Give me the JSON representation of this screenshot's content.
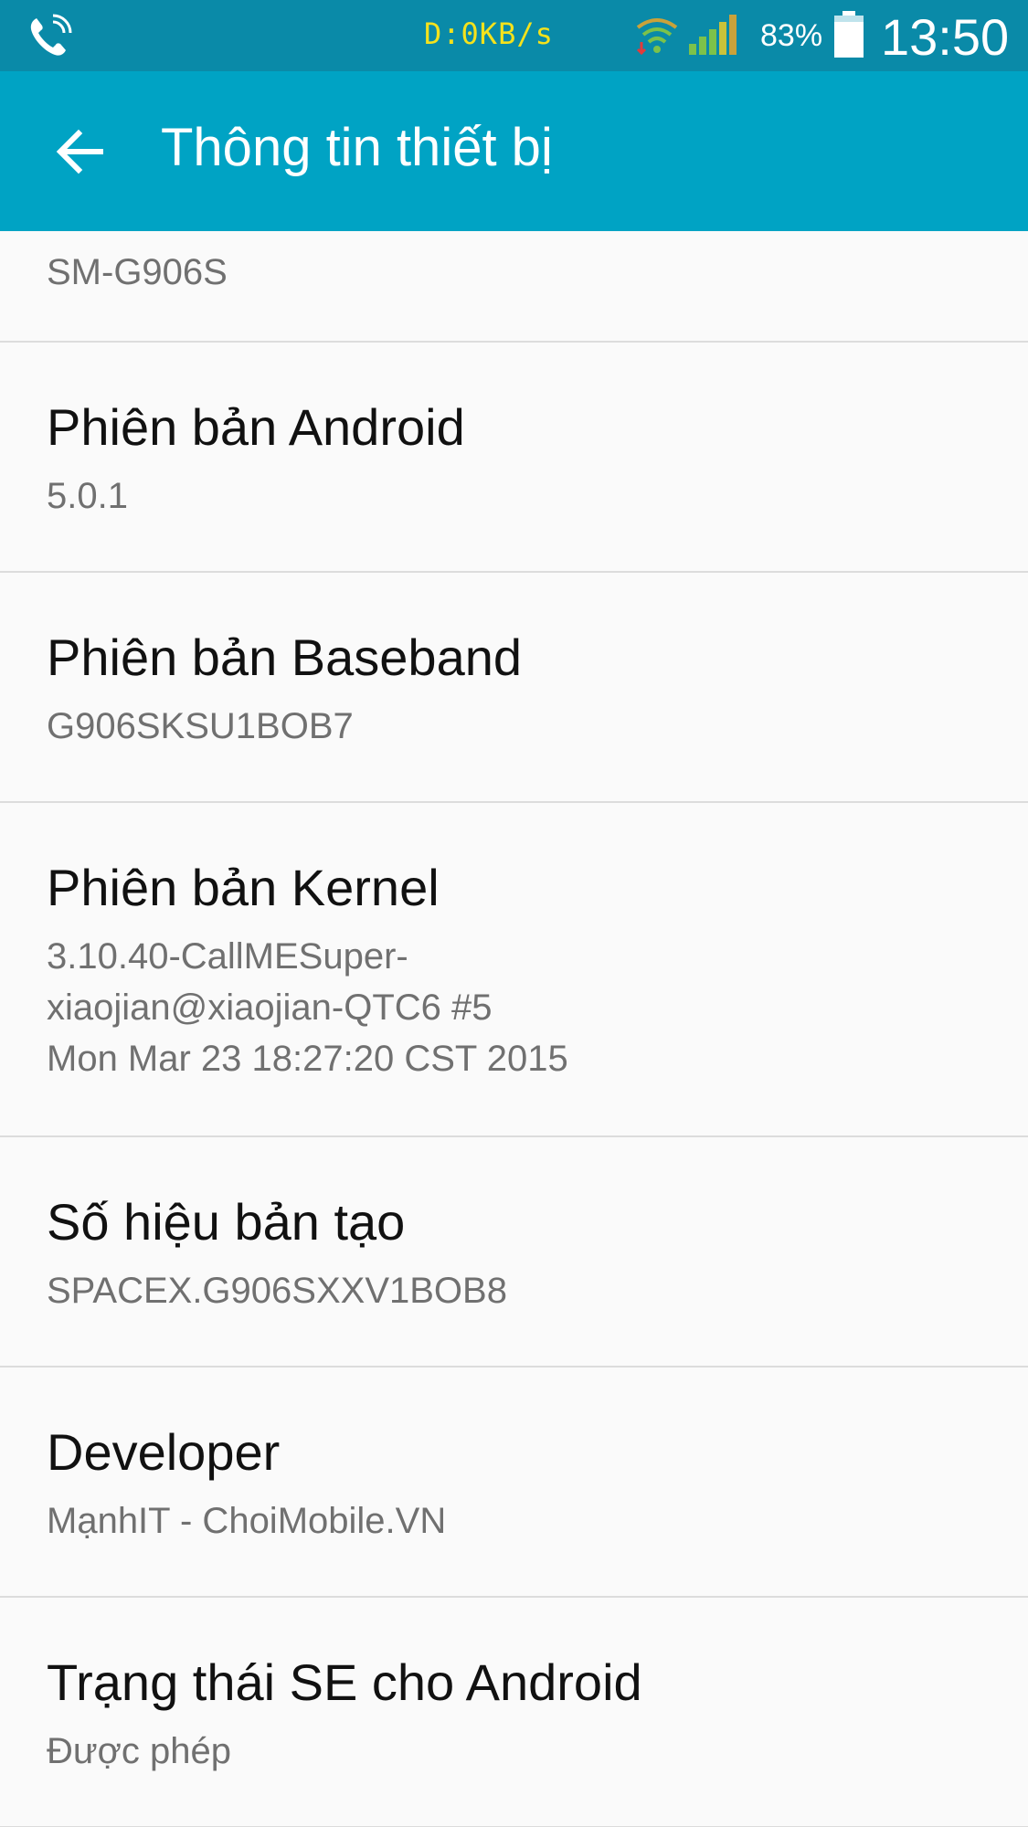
{
  "status_bar": {
    "net_speed": "D:0KB/s",
    "battery_percent": "83%",
    "time": "13:50",
    "icons": [
      "call-icon",
      "wifi-icon",
      "signal-icon",
      "battery-icon"
    ]
  },
  "app_bar": {
    "title": "Thông tin thiết bị",
    "back_icon": "arrow-left-icon"
  },
  "list": {
    "partial_value": "SM-G906S",
    "items": [
      {
        "label": "Phiên bản Android",
        "value": "5.0.1"
      },
      {
        "label": "Phiên bản Baseband",
        "value": "G906SKSU1BOB7"
      },
      {
        "label": "Phiên bản Kernel",
        "value": "3.10.40-CallMESuper-\nxiaojian@xiaojian-QTC6 #5\nMon Mar 23 18:27:20 CST 2015"
      },
      {
        "label": "Số hiệu bản tạo",
        "value": "SPACEX.G906SXXV1BOB8"
      },
      {
        "label": "Developer",
        "value": "MạnhIT - ChoiMobile.VN"
      },
      {
        "label": "Trạng thái SE cho Android",
        "value": "Được phép"
      }
    ]
  },
  "colors": {
    "status_bar": "#0a8aa8",
    "app_bar": "#00a3c4",
    "background": "#fafafa",
    "divider": "#dcdcdc",
    "label_text": "#111111",
    "value_text": "#707070",
    "net_speed_text": "#f4e21c"
  }
}
